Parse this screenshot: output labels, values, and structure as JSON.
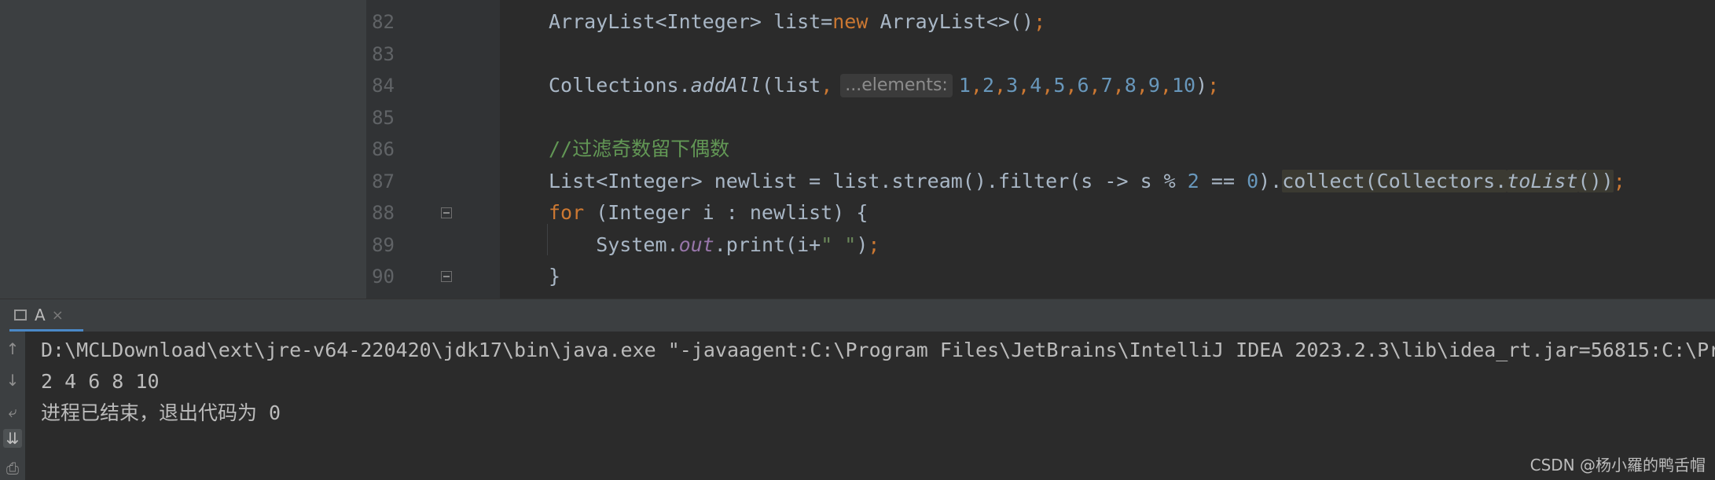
{
  "editor": {
    "lines": [
      {
        "no": "82",
        "parts": [
          {
            "t": "ArrayList<Integer> list="
          },
          {
            "t": "new",
            "c": "kw"
          },
          {
            "t": " ArrayList<>()"
          },
          {
            "t": ";",
            "c": "punc"
          }
        ]
      },
      {
        "no": "83",
        "parts": []
      },
      {
        "no": "84",
        "parts": [
          {
            "t": "Collections."
          },
          {
            "t": "addAll",
            "c": "static"
          },
          {
            "t": "(list"
          },
          {
            "t": ",",
            "c": "punc"
          },
          {
            "t": "...elements:",
            "c": "hint"
          },
          {
            "t": "1",
            "c": "num"
          },
          {
            "t": ",",
            "c": "punc"
          },
          {
            "t": "2",
            "c": "num"
          },
          {
            "t": ",",
            "c": "punc"
          },
          {
            "t": "3",
            "c": "num"
          },
          {
            "t": ",",
            "c": "punc"
          },
          {
            "t": "4",
            "c": "num"
          },
          {
            "t": ",",
            "c": "punc"
          },
          {
            "t": "5",
            "c": "num"
          },
          {
            "t": ",",
            "c": "punc"
          },
          {
            "t": "6",
            "c": "num"
          },
          {
            "t": ",",
            "c": "punc"
          },
          {
            "t": "7",
            "c": "num"
          },
          {
            "t": ",",
            "c": "punc"
          },
          {
            "t": "8",
            "c": "num"
          },
          {
            "t": ",",
            "c": "punc"
          },
          {
            "t": "9",
            "c": "num"
          },
          {
            "t": ",",
            "c": "punc"
          },
          {
            "t": "10",
            "c": "num"
          },
          {
            "t": ")"
          },
          {
            "t": ";",
            "c": "punc"
          }
        ]
      },
      {
        "no": "85",
        "parts": []
      },
      {
        "no": "86",
        "parts": [
          {
            "t": "//过滤奇数留下偶数",
            "c": "cmt"
          }
        ]
      },
      {
        "no": "87",
        "parts": [
          {
            "t": "List<Integer> newlist = list.stream().filter(s -> s % "
          },
          {
            "t": "2",
            "c": "num"
          },
          {
            "t": " == "
          },
          {
            "t": "0",
            "c": "num"
          },
          {
            "t": ")."
          },
          {
            "t": "collect(Collectors.",
            "c": "hl"
          },
          {
            "t": "toList",
            "c": "hl static"
          },
          {
            "t": "())",
            "c": "hl"
          },
          {
            "t": ";",
            "c": "punc"
          }
        ]
      },
      {
        "no": "88",
        "parts": [
          {
            "t": "for",
            "c": "kw"
          },
          {
            "t": " (Integer i : newlist) {"
          }
        ]
      },
      {
        "no": "89",
        "parts": [
          {
            "t": "    System."
          },
          {
            "t": "out",
            "c": "field"
          },
          {
            "t": ".print(i+"
          },
          {
            "t": "\" \"",
            "c": "str"
          },
          {
            "t": ")"
          },
          {
            "t": ";",
            "c": "punc"
          }
        ]
      },
      {
        "no": "90",
        "parts": [
          {
            "t": "}"
          }
        ]
      }
    ]
  },
  "run_tab": {
    "label": "A",
    "close": "×"
  },
  "toolbar": {
    "up": "↑",
    "down": "↓",
    "soft_wrap": "⤶",
    "scroll_end": "⇊",
    "print": "⎙"
  },
  "console": {
    "command": "D:\\MCLDownload\\ext\\jre-v64-220420\\jdk17\\bin\\java.exe \"-javaagent:C:\\Program Files\\JetBrains\\IntelliJ IDEA 2023.2.3\\lib\\idea_rt.jar=56815:C:\\Pr",
    "output": "2 4 6 8 10",
    "exit": "进程已结束，退出代码为 0"
  },
  "watermark": "CSDN @杨小羅的鸭舌帽"
}
